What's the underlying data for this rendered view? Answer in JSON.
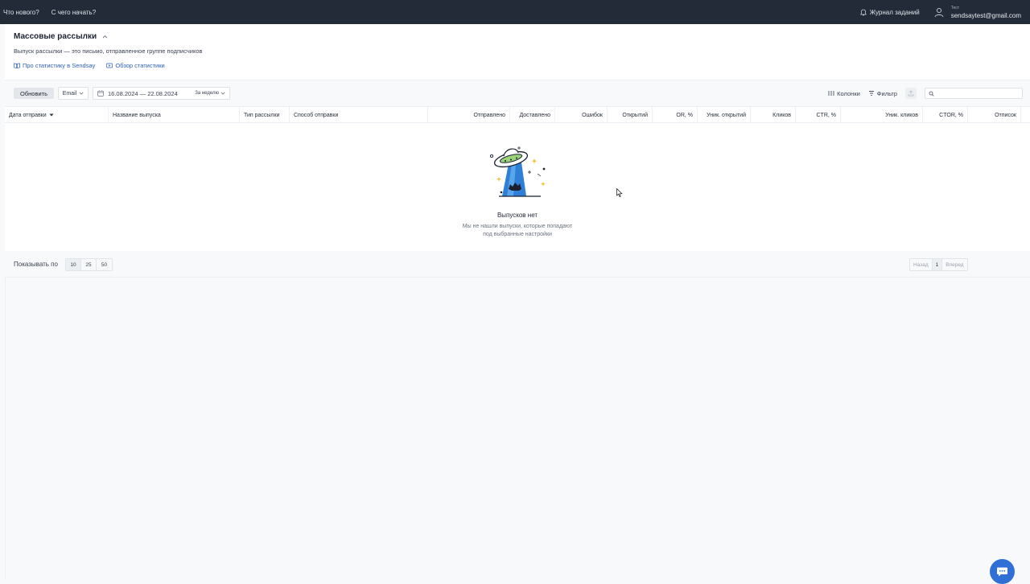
{
  "topbar": {
    "links": [
      "Что нового?",
      "С чего начать?"
    ],
    "journal_label": "Журнал заданий",
    "user_name": "Тест",
    "user_email": "sendsaytest@gmail.com"
  },
  "header": {
    "title": "Массовые рассылки",
    "subtitle": "Выпуск рассылки — это письмо, отправленное группе подписчиков",
    "link_about": "Про статистику в Sendsay",
    "link_overview": "Обзор статистики"
  },
  "toolbar": {
    "refresh_label": "Обновить",
    "channel_value": "Email",
    "date_range": "16.08.2024 — 22.08.2024",
    "period_label": "За неделю",
    "columns_label": "Колонки",
    "filter_label": "Фильтр",
    "search_placeholder": ""
  },
  "table": {
    "columns": [
      "Дата отправки",
      "Название выпуска",
      "Тип рассылки",
      "Способ отправки",
      "Отправлено",
      "Доставлено",
      "Ошибок",
      "Открытий",
      "OR, %",
      "Уник. открытий",
      "Кликов",
      "CTR, %",
      "Уник. кликов",
      "CTOR, %",
      "Отписок"
    ]
  },
  "empty": {
    "title": "Выпусков нет",
    "line1": "Мы не нашли выпуски, которые попадают",
    "line2": "под выбранные настройки"
  },
  "pager": {
    "show_label": "Показывать по",
    "sizes": [
      "10",
      "25",
      "50"
    ],
    "prev_label": "Назад",
    "current_page": "1",
    "next_label": "Вперед"
  },
  "colors": {
    "topbar": "#232b38",
    "accent": "#2f6fd6",
    "link": "#2b5fb8"
  }
}
